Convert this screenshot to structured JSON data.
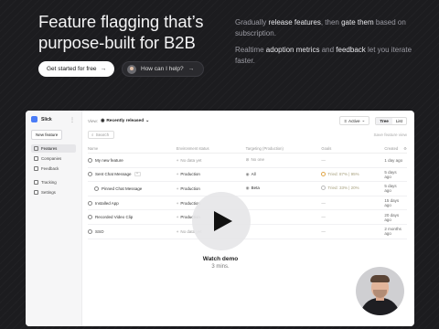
{
  "hero": {
    "title": "Feature flagging that’s purpose-built for B2B",
    "desc1_pre": "Gradually ",
    "desc1_b1": "release features",
    "desc1_mid": ", then ",
    "desc1_b2": "gate them",
    "desc1_post": " based on subscription.",
    "desc2_pre": "Realtime ",
    "desc2_b1": "adoption metrics",
    "desc2_mid": " and ",
    "desc2_b2": "feedback",
    "desc2_post": " let you iterate faster.",
    "cta_primary": "Get started for free",
    "cta_secondary": "How can I help?"
  },
  "app": {
    "brand": "Slick",
    "new_feature": "New feature",
    "nav": [
      {
        "label": "Features",
        "active": true
      },
      {
        "label": "Companies"
      },
      {
        "label": "Feedback"
      },
      {
        "label": "Tracking"
      },
      {
        "label": "Settings"
      }
    ],
    "view_label": "View:",
    "view_value": "Recently released",
    "filter_value": "Active",
    "seg_tree": "Tree",
    "seg_list": "List",
    "search_placeholder": "Search",
    "save_view": "Save feature view",
    "columns": [
      "Name",
      "Environment status",
      "Targeting (Production)",
      "Goals",
      "Created"
    ],
    "rows": [
      {
        "name": "My new feature",
        "env": "No data yet",
        "target": "No one",
        "goals": "—",
        "created": "1 day ago"
      },
      {
        "name": "Sent Chat Message",
        "env": "Production",
        "target": "All",
        "goals": "Tried: 87% | 95%",
        "created": "5 days ago"
      },
      {
        "name": "Pinned Chat Message",
        "env": "Production",
        "target": "Beta",
        "goals": "Tried: 33% | 20%",
        "created": "5 days ago"
      },
      {
        "name": "Installed App",
        "env": "Production",
        "target": "",
        "goals": "—",
        "created": "15 days ago"
      },
      {
        "name": "Recorded Video Clip",
        "env": "Production",
        "target": "",
        "goals": "—",
        "created": "20 days ago"
      },
      {
        "name": "SSO",
        "env": "No data yet",
        "target": "",
        "goals": "—",
        "created": "2 months ago"
      }
    ]
  },
  "video": {
    "title": "Watch demo",
    "duration": "3 mins."
  },
  "colors": {
    "accent": "#4a7cf7",
    "background": "#1c1c1f"
  }
}
